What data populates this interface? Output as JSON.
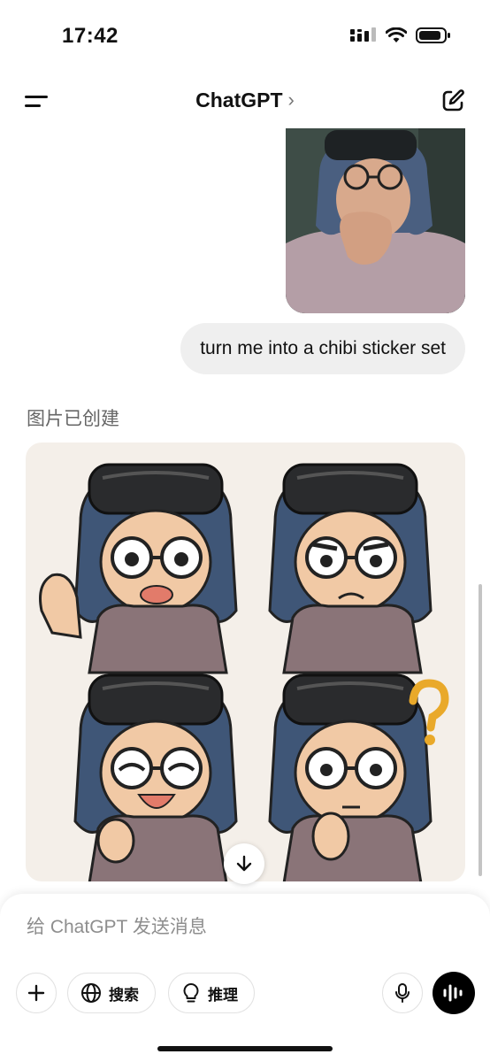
{
  "status_bar": {
    "time": "17:42"
  },
  "header": {
    "title": "ChatGPT",
    "title_chevron": "›"
  },
  "chat": {
    "user_message": "turn me into a chibi sticker set",
    "assistant_status": "图片已创建"
  },
  "composer": {
    "placeholder": "给 ChatGPT 发送消息",
    "search_label": "搜索",
    "reason_label": "推理"
  },
  "icons": {
    "menu": "menu-icon",
    "compose": "compose-icon",
    "scroll_down": "arrow-down-icon",
    "add": "plus-icon",
    "search": "globe-icon",
    "reason": "lightbulb-icon",
    "mic": "microphone-icon",
    "voice": "voice-wave-icon"
  },
  "colors": {
    "user_bubble": "#efefef",
    "sheet_background": "#f4efe9",
    "voice_button": "#000000"
  }
}
